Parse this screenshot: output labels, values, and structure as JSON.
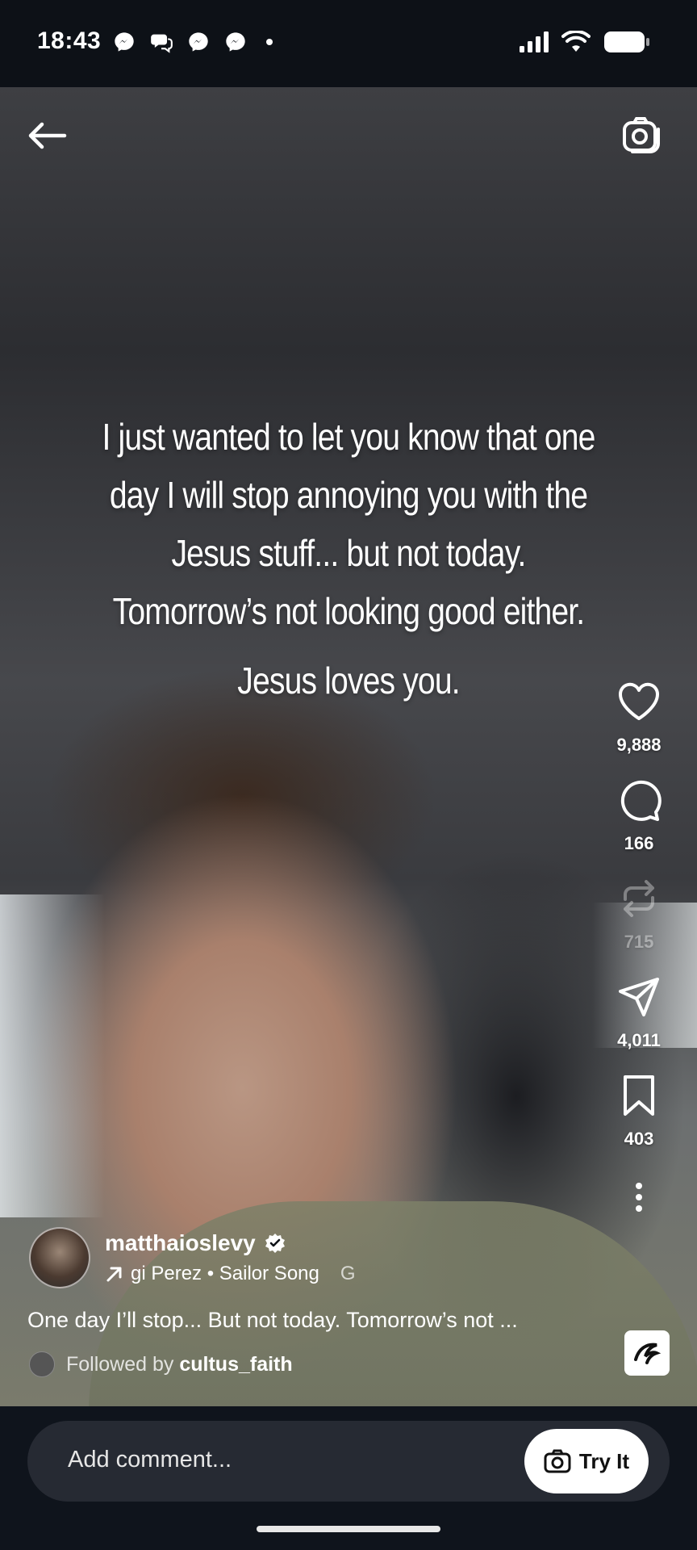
{
  "status_bar": {
    "time": "18:43",
    "notification_icons": [
      "messenger-icon",
      "chat-bubbles-icon",
      "messenger-icon",
      "messenger-icon"
    ],
    "system_icons": [
      "signal-icon",
      "wifi-icon",
      "battery-icon"
    ]
  },
  "top_bar": {
    "back_icon": "arrow-left-icon",
    "camera_icon": "camera-icon"
  },
  "overlay_text": {
    "lines": [
      "I just wanted to let you know that one",
      "day I will stop annoying you with the",
      "Jesus stuff... but not today.",
      "Tomorrow’s not looking good either.",
      "Jesus loves you."
    ]
  },
  "actions": {
    "like": {
      "icon": "heart-icon",
      "count": "9,888"
    },
    "comment": {
      "icon": "comment-icon",
      "count": "166"
    },
    "remix": {
      "icon": "repost-icon",
      "count": "715"
    },
    "share": {
      "icon": "send-icon",
      "count": "4,011"
    },
    "save": {
      "icon": "bookmark-icon",
      "count": "403"
    },
    "more": {
      "icon": "more-vertical-icon"
    }
  },
  "author": {
    "username": "matthaioslevy",
    "verified": true,
    "music": "gi Perez • Sailor Song",
    "music_suffix": "G"
  },
  "caption": "One day I’ll stop... But not today. Tomorrow’s not ...",
  "followed_by": {
    "prefix": "Followed by",
    "user": "cultus_faith"
  },
  "comment_bar": {
    "placeholder": "Add comment...",
    "try_it_label": "Try It"
  },
  "colors": {
    "background": "#0d1117",
    "bottom_bar": "#0f141c",
    "comment_box": "#262a33",
    "text": "#ffffff"
  }
}
